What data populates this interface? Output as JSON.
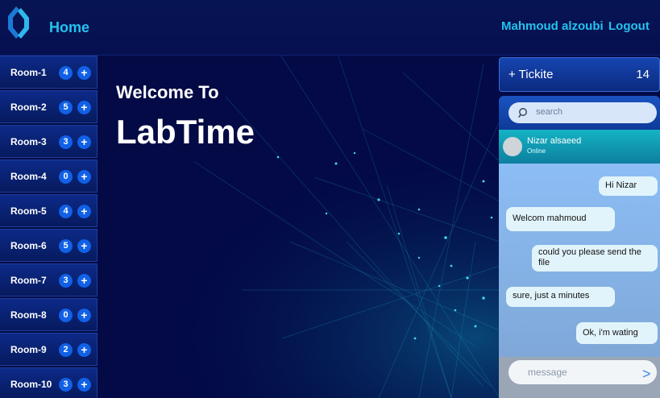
{
  "header": {
    "home_label": "Home",
    "user_name": "Mahmoud alzoubi",
    "logout_label": "Logout"
  },
  "sidebar": {
    "rooms": [
      {
        "label": "Room-1",
        "count": "4",
        "action": "+"
      },
      {
        "label": "Room-2",
        "count": "5",
        "action": "+"
      },
      {
        "label": "Room-3",
        "count": "3",
        "action": "+"
      },
      {
        "label": "Room-4",
        "count": "0",
        "action": "+"
      },
      {
        "label": "Room-5",
        "count": "4",
        "action": "+"
      },
      {
        "label": "Room-6",
        "count": "5",
        "action": "+"
      },
      {
        "label": "Room-7",
        "count": "3",
        "action": "+"
      },
      {
        "label": "Room-8",
        "count": "0",
        "action": "+"
      },
      {
        "label": "Room-9",
        "count": "2",
        "action": "+"
      },
      {
        "label": "Room-10",
        "count": "3",
        "action": "+"
      }
    ]
  },
  "hero": {
    "welcome": "Welcome To",
    "brand": "LabTime"
  },
  "ticket": {
    "label": "+ Tickite",
    "count": "14"
  },
  "chat": {
    "search_placeholder": "search",
    "contact_name": "Nizar alsaeed",
    "contact_status": "Online",
    "messages": [
      {
        "text": "Hi Nizar",
        "side": "right"
      },
      {
        "text": "Welcom mahmoud",
        "side": "left"
      },
      {
        "text": "could you please send the file",
        "side": "right"
      },
      {
        "text": "sure, just a minutes",
        "side": "left"
      },
      {
        "text": "Ok, i'm wating",
        "side": "right"
      }
    ],
    "message_placeholder": "message",
    "send_symbol": ">"
  },
  "colors": {
    "background": "#030a45",
    "accent": "#24c3ee",
    "badge": "#1160e6"
  }
}
